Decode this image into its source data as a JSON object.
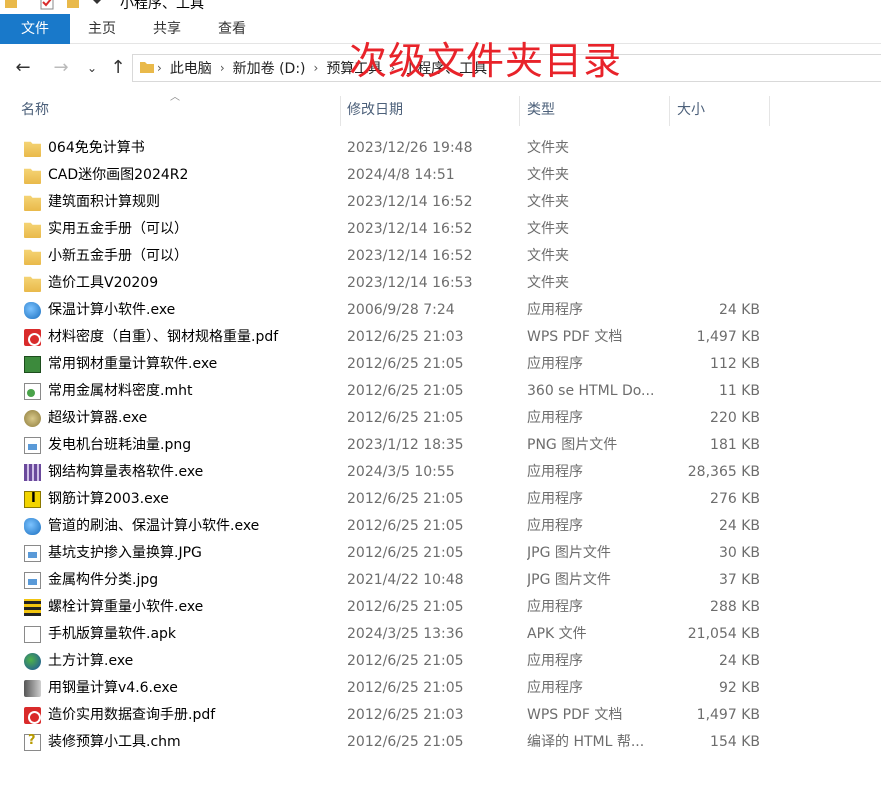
{
  "window": {
    "title": "小程序、工具"
  },
  "ribbon": {
    "tabs": [
      "文件",
      "主页",
      "共享",
      "查看"
    ]
  },
  "address": {
    "crumbs": [
      "此电脑",
      "新加卷 (D:)",
      "预算工具",
      "小程序、工具"
    ]
  },
  "overlay": {
    "text": "次级文件夹目录",
    "color": "#e8232a"
  },
  "columns": {
    "name": "名称",
    "date": "修改日期",
    "type": "类型",
    "size": "大小"
  },
  "files": [
    {
      "icon": "folder-icon",
      "name": "064免免计算书",
      "date": "2023/12/26 19:48",
      "type": "文件夹",
      "size": ""
    },
    {
      "icon": "folder-icon",
      "name": "CAD迷你画图2024R2",
      "date": "2024/4/8 14:51",
      "type": "文件夹",
      "size": ""
    },
    {
      "icon": "folder-icon",
      "name": "建筑面积计算规则",
      "date": "2023/12/14 16:52",
      "type": "文件夹",
      "size": ""
    },
    {
      "icon": "folder-icon",
      "name": "实用五金手册（可以）",
      "date": "2023/12/14 16:52",
      "type": "文件夹",
      "size": ""
    },
    {
      "icon": "folder-icon",
      "name": "小新五金手册（可以）",
      "date": "2023/12/14 16:52",
      "type": "文件夹",
      "size": ""
    },
    {
      "icon": "folder-icon",
      "name": "造价工具V20209",
      "date": "2023/12/14 16:53",
      "type": "文件夹",
      "size": ""
    },
    {
      "icon": "app-icon",
      "name": "保温计算小软件.exe",
      "date": "2006/9/28 7:24",
      "type": "应用程序",
      "size": "24 KB"
    },
    {
      "icon": "pdf-icon",
      "name": "材料密度（自重）、钢材规格重量.pdf",
      "date": "2012/6/25 21:03",
      "type": "WPS PDF 文档",
      "size": "1,497 KB"
    },
    {
      "icon": "calculator-icon",
      "name": "常用钢材重量计算软件.exe",
      "date": "2012/6/25 21:05",
      "type": "应用程序",
      "size": "112 KB"
    },
    {
      "icon": "mht-icon",
      "name": "常用金属材料密度.mht",
      "date": "2012/6/25 21:05",
      "type": "360 se HTML Do...",
      "size": "11 KB"
    },
    {
      "icon": "round-app-icon",
      "name": "超级计算器.exe",
      "date": "2012/6/25 21:05",
      "type": "应用程序",
      "size": "220 KB"
    },
    {
      "icon": "image-icon",
      "name": "发电机台班耗油量.png",
      "date": "2023/1/12 18:35",
      "type": "PNG 图片文件",
      "size": "181 KB"
    },
    {
      "icon": "grid-app-icon",
      "name": "钢结构算量表格软件.exe",
      "date": "2024/3/5 10:55",
      "type": "应用程序",
      "size": "28,365 KB"
    },
    {
      "icon": "yellow-app-icon",
      "name": "钢筋计算2003.exe",
      "date": "2012/6/25 21:05",
      "type": "应用程序",
      "size": "276 KB"
    },
    {
      "icon": "app-icon",
      "name": "管道的刷油、保温计算小软件.exe",
      "date": "2012/6/25 21:05",
      "type": "应用程序",
      "size": "24 KB"
    },
    {
      "icon": "image-icon",
      "name": "基坑支护掺入量换算.JPG",
      "date": "2012/6/25 21:05",
      "type": "JPG 图片文件",
      "size": "30 KB"
    },
    {
      "icon": "image-icon",
      "name": "金属构件分类.jpg",
      "date": "2021/4/22 10:48",
      "type": "JPG 图片文件",
      "size": "37 KB"
    },
    {
      "icon": "bolt-app-icon",
      "name": "螺栓计算重量小软件.exe",
      "date": "2012/6/25 21:05",
      "type": "应用程序",
      "size": "288 KB"
    },
    {
      "icon": "document-icon",
      "name": "手机版算量软件.apk",
      "date": "2024/3/25 13:36",
      "type": "APK 文件",
      "size": "21,054 KB"
    },
    {
      "icon": "globe-icon",
      "name": "土方计算.exe",
      "date": "2012/6/25 21:05",
      "type": "应用程序",
      "size": "24 KB"
    },
    {
      "icon": "gray-app-icon",
      "name": "用钢量计算v4.6.exe",
      "date": "2012/6/25 21:05",
      "type": "应用程序",
      "size": "92 KB"
    },
    {
      "icon": "pdf-icon",
      "name": "造价实用数据查询手册.pdf",
      "date": "2012/6/25 21:03",
      "type": "WPS PDF 文档",
      "size": "1,497 KB"
    },
    {
      "icon": "chm-icon",
      "name": "装修预算小工具.chm",
      "date": "2012/6/25 21:05",
      "type": "编译的 HTML 帮...",
      "size": "154 KB"
    }
  ]
}
